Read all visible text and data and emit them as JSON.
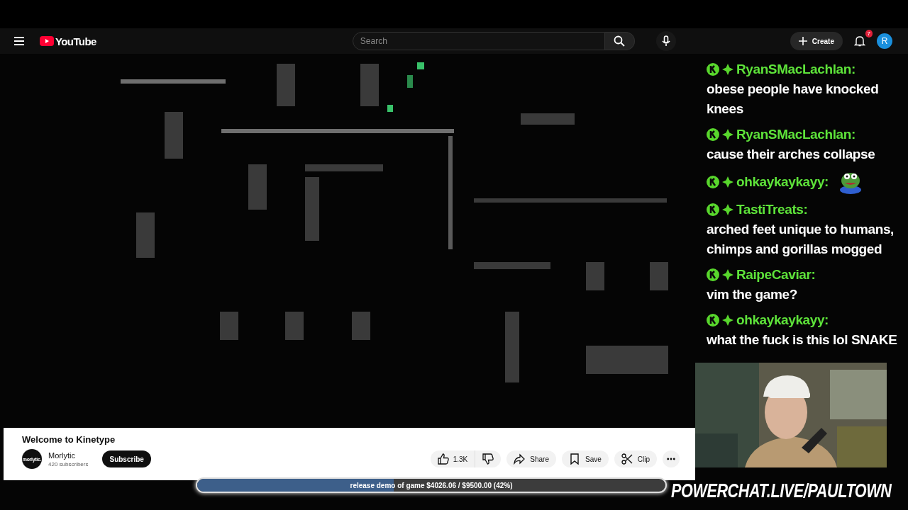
{
  "header": {
    "logo_text": "YouTube",
    "search": {
      "placeholder": "Search"
    },
    "create_label": "Create",
    "notification_count": "7",
    "avatar_letter": "R"
  },
  "chat": [
    {
      "kind": "text",
      "user": "RyanSMacLachlan:",
      "message": "obese people have knocked knees"
    },
    {
      "kind": "text",
      "user": "RyanSMacLachlan:",
      "message": "cause their arches collapse"
    },
    {
      "kind": "emote",
      "user": "ohkaykaykayy:"
    },
    {
      "kind": "text",
      "user": "TastiTreats:",
      "message": "arched feet unique to humans, chimps and gorillas mogged"
    },
    {
      "kind": "text",
      "user": "RaipeCaviar:",
      "message": "vim the game?"
    },
    {
      "kind": "text",
      "user": "ohkaykaykayy:",
      "message": "what the fuck is this lol SNAKE"
    }
  ],
  "video_info": {
    "title": "Welcome to Kinetype",
    "channel": "Morlytic",
    "channel_logo_text": "morlytic.",
    "subscribers": "420 subscribers",
    "subscribe_label": "Subscribe",
    "likes": "1.3K",
    "actions": [
      {
        "kind": "share",
        "label": "Share"
      },
      {
        "kind": "save",
        "label": "Save"
      },
      {
        "kind": "clip",
        "label": "Clip"
      }
    ]
  },
  "goal_bar": {
    "label": "release demo of game $4026.06 / $9500.00 (42%)",
    "level": 0.42
  },
  "overlay_text": "POWERCHAT.LIVE/PAULTOWN"
}
